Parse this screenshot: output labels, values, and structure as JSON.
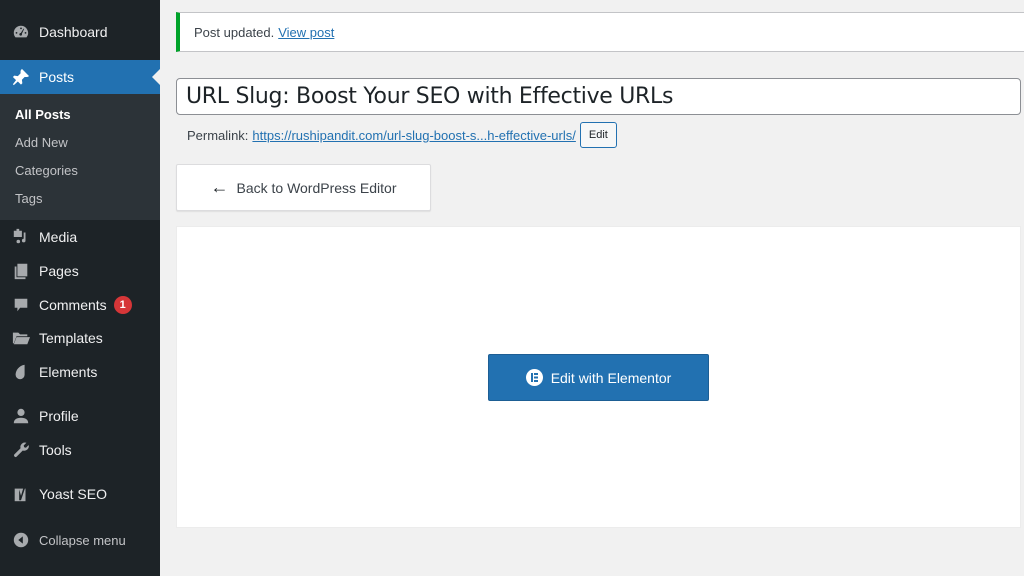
{
  "sidebar": {
    "items": [
      {
        "label": "Dashboard",
        "icon": "dashboard-icon"
      },
      {
        "label": "Posts",
        "icon": "pin-icon",
        "active": true
      },
      {
        "label": "Media",
        "icon": "media-icon"
      },
      {
        "label": "Pages",
        "icon": "pages-icon"
      },
      {
        "label": "Comments",
        "icon": "comment-icon",
        "badge": "1"
      },
      {
        "label": "Templates",
        "icon": "folder-icon"
      },
      {
        "label": "Elements",
        "icon": "elements-icon"
      },
      {
        "label": "Profile",
        "icon": "user-icon"
      },
      {
        "label": "Tools",
        "icon": "wrench-icon"
      },
      {
        "label": "Yoast SEO",
        "icon": "yoast-icon"
      },
      {
        "label": "Collapse menu",
        "icon": "collapse-icon"
      }
    ],
    "submenu": [
      {
        "label": "All Posts",
        "current": true
      },
      {
        "label": "Add New"
      },
      {
        "label": "Categories"
      },
      {
        "label": "Tags"
      }
    ]
  },
  "notice": {
    "text": "Post updated.",
    "link": "View post",
    "accent_color": "#00a32a"
  },
  "post": {
    "title": "URL Slug: Boost Your SEO with Effective URLs",
    "permalink_label": "Permalink:",
    "permalink_url": "https://rushipandit.com/url-slug-boost-s...h-effective-urls/",
    "permalink_edit": "Edit"
  },
  "editor": {
    "back_label": "Back to WordPress Editor",
    "elementor_label": "Edit with Elementor",
    "brand_color": "#2271b1"
  }
}
